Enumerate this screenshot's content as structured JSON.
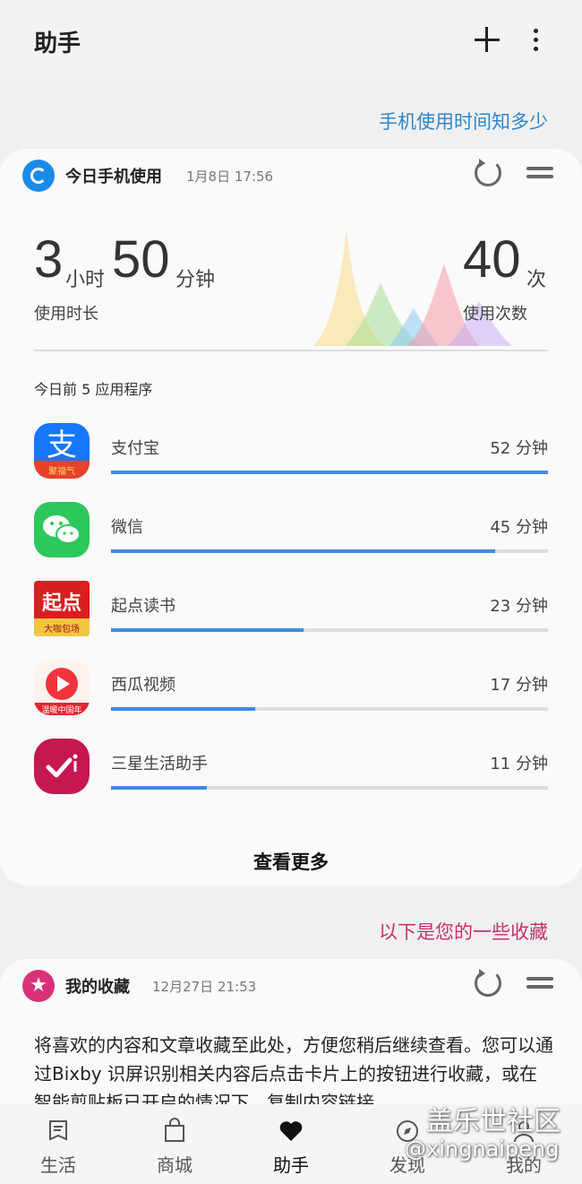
{
  "header": {
    "title": "助手"
  },
  "usage_section_link": "手机使用时间知多少",
  "usage_card": {
    "title": "今日手机使用",
    "timestamp": "1月8日 17:56",
    "hours": "3",
    "hours_unit": "小时",
    "minutes": "50",
    "minutes_unit": "分钟",
    "duration_label": "使用时长",
    "opens": "40",
    "opens_unit": "次",
    "opens_label": "使用次数",
    "top_apps_label": "今日前 5 应用程序",
    "apps": [
      {
        "name": "支付宝",
        "minutes": "52 分钟",
        "fraction": 1.0
      },
      {
        "name": "微信",
        "minutes": "45 分钟",
        "fraction": 0.88
      },
      {
        "name": "起点读书",
        "minutes": "23 分钟",
        "fraction": 0.44
      },
      {
        "name": "西瓜视频",
        "minutes": "17 分钟",
        "fraction": 0.33
      },
      {
        "name": "三星生活助手",
        "minutes": "11 分钟",
        "fraction": 0.22
      }
    ],
    "app_icon_text": {
      "alipay": "支",
      "alipay_badge": "聚福气",
      "qidian": "起点",
      "qidian_badge": "大咖包场",
      "xigua_badge": "温暖中国年"
    },
    "see_more": "查看更多"
  },
  "favorites_section_link": "以下是您的一些收藏",
  "favorites_card": {
    "title": "我的收藏",
    "timestamp": "12月27日 21:53",
    "body": "将喜欢的内容和文章收藏至此处，方便您稍后继续查看。您可以通过Bixby 识屏识别相关内容后点击卡片上的按钮进行收藏，或在智能剪贴板已开启的情况下，复制内容链接"
  },
  "bottom_nav": [
    {
      "label": "生活",
      "icon": "book-icon"
    },
    {
      "label": "商城",
      "icon": "shopping-bag-icon"
    },
    {
      "label": "助手",
      "icon": "heart-icon",
      "active": true
    },
    {
      "label": "发现",
      "icon": "compass-icon"
    },
    {
      "label": "我的",
      "icon": "person-icon"
    }
  ],
  "watermark": {
    "line1": "盖乐世社区",
    "line2": "@xingnaipeng"
  },
  "colors": {
    "accent_blue": "#3f8be3",
    "link_blue": "#2f86c9",
    "link_pink": "#c8306e",
    "fav_icon": "#d8317a"
  }
}
